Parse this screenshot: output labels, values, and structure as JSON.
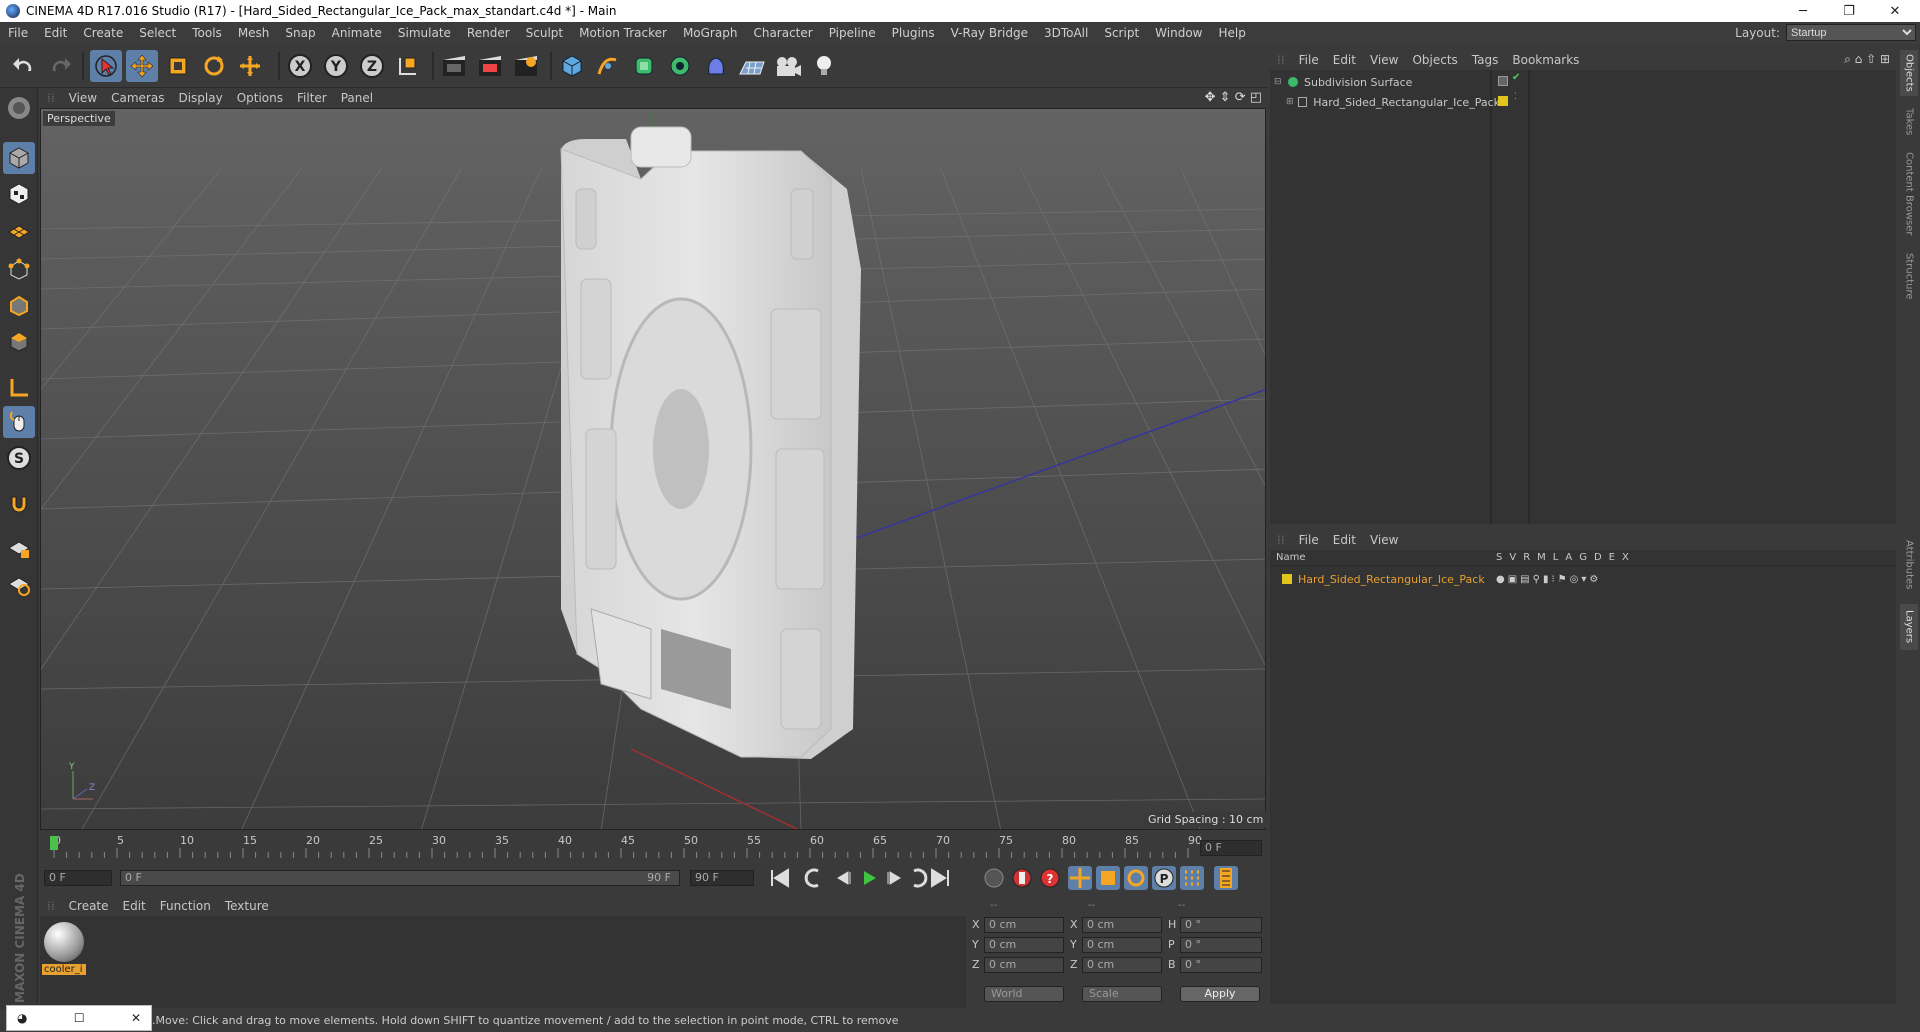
{
  "window": {
    "title": "CINEMA 4D R17.016 Studio (R17) - [Hard_Sided_Rectangular_Ice_Pack_max_standart.c4d *] - Main"
  },
  "menu": [
    "File",
    "Edit",
    "Create",
    "Select",
    "Tools",
    "Mesh",
    "Snap",
    "Animate",
    "Simulate",
    "Render",
    "Sculpt",
    "Motion Tracker",
    "MoGraph",
    "Character",
    "Pipeline",
    "Plugins",
    "V-Ray Bridge",
    "3DToAll",
    "Script",
    "Window",
    "Help"
  ],
  "layout": {
    "label": "Layout:",
    "value": "Startup"
  },
  "viewport": {
    "menu": [
      "View",
      "Cameras",
      "Display",
      "Options",
      "Filter",
      "Panel"
    ],
    "camera_label": "Perspective",
    "grid_spacing": "Grid Spacing : 10 cm"
  },
  "timeline": {
    "ticks": [
      "0",
      "5",
      "10",
      "15",
      "20",
      "25",
      "30",
      "35",
      "40",
      "45",
      "50",
      "55",
      "60",
      "65",
      "70",
      "75",
      "80",
      "85",
      "90"
    ],
    "current_frame": "0 F",
    "start_field": "0 F",
    "range_start": "0 F",
    "range_end": "90 F",
    "end_field": "90 F"
  },
  "material_manager": {
    "menu": [
      "Create",
      "Edit",
      "Function",
      "Texture"
    ],
    "materials": [
      {
        "name": "cooler_i"
      }
    ]
  },
  "coordinates": {
    "headers": [
      "--",
      "--",
      "--"
    ],
    "rows": [
      {
        "a": "X",
        "av": "0 cm",
        "b": "X",
        "bv": "0 cm",
        "c": "H",
        "cv": "0 °"
      },
      {
        "a": "Y",
        "av": "0 cm",
        "b": "Y",
        "bv": "0 cm",
        "c": "P",
        "cv": "0 °"
      },
      {
        "a": "Z",
        "av": "0 cm",
        "b": "Z",
        "bv": "0 cm",
        "c": "B",
        "cv": "0 °"
      }
    ],
    "mode_world": "World",
    "mode_scale": "Scale",
    "apply": "Apply"
  },
  "object_manager": {
    "menu": [
      "File",
      "Edit",
      "View",
      "Objects",
      "Tags",
      "Bookmarks"
    ],
    "objects": [
      {
        "name": "Subdivision Surface"
      },
      {
        "name": "Hard_Sided_Rectangular_Ice_Pack"
      }
    ]
  },
  "layer_manager": {
    "menu": [
      "File",
      "Edit",
      "View"
    ],
    "header_name": "Name",
    "flags": [
      "S",
      "V",
      "R",
      "M",
      "L",
      "A",
      "G",
      "D",
      "E",
      "X"
    ],
    "layers": [
      {
        "name": "Hard_Sided_Rectangular_Ice_Pack",
        "color": "#e2c51c"
      }
    ]
  },
  "side_tabs": [
    "Objects",
    "Takes",
    "Content Browser",
    "Structure",
    "Attributes",
    "Layers"
  ],
  "status": "Move: Click and drag to move elements. Hold down SHIFT to quantize movement / add to the selection in point mode, CTRL to remove.",
  "brand": "MAXON CINEMA 4D",
  "colors": {
    "accent": "#5d7fa8",
    "layer": "#e2c51c",
    "active_obj": "#e8a030"
  }
}
